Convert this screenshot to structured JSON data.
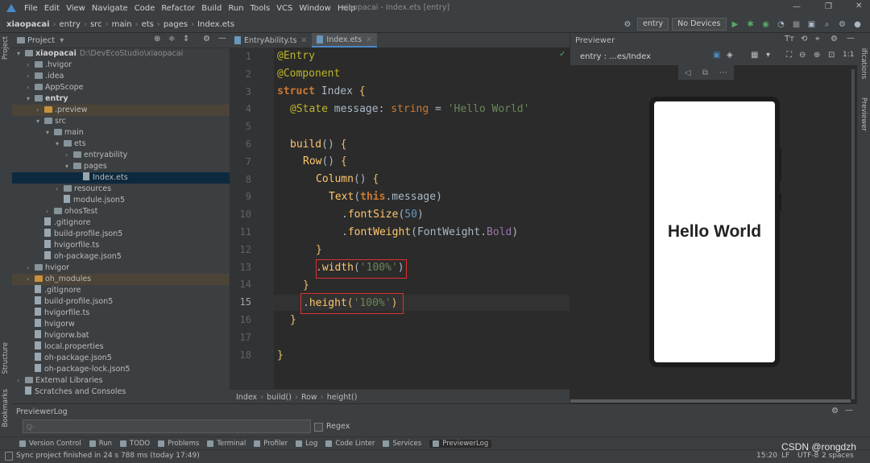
{
  "menu": [
    "File",
    "Edit",
    "View",
    "Navigate",
    "Code",
    "Refactor",
    "Build",
    "Run",
    "Tools",
    "VCS",
    "Window",
    "Help"
  ],
  "window_title": "xiaopacai - Index.ets [entry]",
  "breadcrumb": [
    "xiaopacai",
    "entry",
    "src",
    "main",
    "ets",
    "pages",
    "Index.ets"
  ],
  "run_config": "entry",
  "device": "No Devices",
  "project_panel": {
    "title": "Project",
    "tree": [
      {
        "label": "xiaopacai",
        "extra": "D:\\DevEcoStudio\\xiaopacai",
        "indent": 0,
        "arrow": "open",
        "icon": "folder",
        "bold": true
      },
      {
        "label": ".hvigor",
        "indent": 1,
        "arrow": "closed",
        "icon": "folder"
      },
      {
        "label": ".idea",
        "indent": 1,
        "arrow": "closed",
        "icon": "folder"
      },
      {
        "label": "AppScope",
        "indent": 1,
        "arrow": "closed",
        "icon": "folder"
      },
      {
        "label": "entry",
        "indent": 1,
        "arrow": "open",
        "icon": "folder",
        "bold": true
      },
      {
        "label": ".preview",
        "indent": 2,
        "arrow": "closed",
        "icon": "folder-orange",
        "hl": true
      },
      {
        "label": "src",
        "indent": 2,
        "arrow": "open",
        "icon": "folder"
      },
      {
        "label": "main",
        "indent": 3,
        "arrow": "open",
        "icon": "folder"
      },
      {
        "label": "ets",
        "indent": 4,
        "arrow": "open",
        "icon": "folder"
      },
      {
        "label": "entryability",
        "indent": 5,
        "arrow": "closed",
        "icon": "folder"
      },
      {
        "label": "pages",
        "indent": 5,
        "arrow": "open",
        "icon": "folder"
      },
      {
        "label": "Index.ets",
        "indent": 6,
        "arrow": "none",
        "icon": "file",
        "selected": true
      },
      {
        "label": "resources",
        "indent": 4,
        "arrow": "closed",
        "icon": "folder"
      },
      {
        "label": "module.json5",
        "indent": 4,
        "arrow": "none",
        "icon": "file"
      },
      {
        "label": "ohosTest",
        "indent": 3,
        "arrow": "closed",
        "icon": "folder"
      },
      {
        "label": ".gitignore",
        "indent": 2,
        "arrow": "none",
        "icon": "file"
      },
      {
        "label": "build-profile.json5",
        "indent": 2,
        "arrow": "none",
        "icon": "file"
      },
      {
        "label": "hvigorfile.ts",
        "indent": 2,
        "arrow": "none",
        "icon": "file"
      },
      {
        "label": "oh-package.json5",
        "indent": 2,
        "arrow": "none",
        "icon": "file"
      },
      {
        "label": "hvigor",
        "indent": 1,
        "arrow": "closed",
        "icon": "folder"
      },
      {
        "label": "oh_modules",
        "indent": 1,
        "arrow": "closed",
        "icon": "folder-orange",
        "hl": true
      },
      {
        "label": ".gitignore",
        "indent": 1,
        "arrow": "none",
        "icon": "file"
      },
      {
        "label": "build-profile.json5",
        "indent": 1,
        "arrow": "none",
        "icon": "file"
      },
      {
        "label": "hvigorfile.ts",
        "indent": 1,
        "arrow": "none",
        "icon": "file"
      },
      {
        "label": "hvigorw",
        "indent": 1,
        "arrow": "none",
        "icon": "file"
      },
      {
        "label": "hvigorw.bat",
        "indent": 1,
        "arrow": "none",
        "icon": "file"
      },
      {
        "label": "local.properties",
        "indent": 1,
        "arrow": "none",
        "icon": "file"
      },
      {
        "label": "oh-package.json5",
        "indent": 1,
        "arrow": "none",
        "icon": "file"
      },
      {
        "label": "oh-package-lock.json5",
        "indent": 1,
        "arrow": "none",
        "icon": "file"
      },
      {
        "label": "External Libraries",
        "indent": 0,
        "arrow": "closed",
        "icon": "folder"
      },
      {
        "label": "Scratches and Consoles",
        "indent": 0,
        "arrow": "none",
        "icon": "file"
      }
    ]
  },
  "editor_tabs": [
    "EntryAbility.ts",
    "Index.ets"
  ],
  "code_lines": [
    "1",
    "2",
    "3",
    "4",
    "5",
    "6",
    "7",
    "8",
    "9",
    "10",
    "11",
    "12",
    "13",
    "14",
    "15",
    "16",
    "17",
    "18"
  ],
  "code_breadcrumb": [
    "Index",
    "build()",
    "Row",
    "height()"
  ],
  "previewer": {
    "title": "Previewer",
    "path": "entry : ...es/Index",
    "hello": "Hello World"
  },
  "bottom_panel": {
    "title": "PreviewerLog",
    "search_placeholder": "Q-",
    "regex_label": "Regex"
  },
  "tool_windows": [
    "Version Control",
    "Run",
    "TODO",
    "Problems",
    "Terminal",
    "Profiler",
    "Log",
    "Code Linter",
    "Services",
    "PreviewerLog"
  ],
  "side_labels": {
    "left_top": "Project",
    "left_bottom": "Structure",
    "left_bottom2": "Bookmarks",
    "right_top": "Notifications",
    "right_mid": "Previewer"
  },
  "status": {
    "message": "Sync project finished in 24 s 788 ms (today 17:49)",
    "position": "15:20",
    "line_sep": "LF",
    "encoding": "UTF-8",
    "indent": "2 spaces",
    "watermark": "CSDN @rongdzh"
  }
}
